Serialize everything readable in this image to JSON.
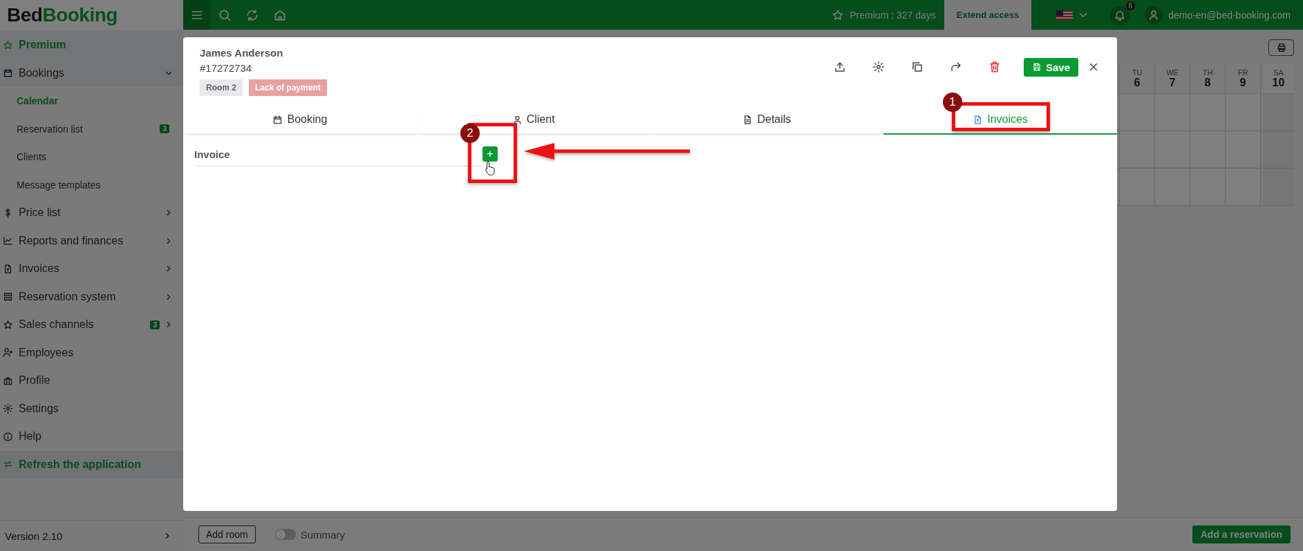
{
  "topbar": {
    "logo": {
      "first": "Bed",
      "second": "Booking"
    },
    "premium": "Premium : 327 days",
    "extend": "Extend access",
    "notifications": "6",
    "user": "demo-en@bed-booking.com"
  },
  "sidebar": {
    "items": [
      {
        "kind": "premium",
        "label": "Premium"
      },
      {
        "kind": "group",
        "label": "Bookings",
        "expanded": true,
        "children": [
          {
            "label": "Calendar",
            "selected": true
          },
          {
            "label": "Reservation list",
            "selected": false,
            "badge": "3"
          },
          {
            "label": "Clients",
            "selected": false
          },
          {
            "label": "Message templates",
            "selected": false
          }
        ]
      },
      {
        "kind": "group",
        "label": "Price list",
        "expanded": false
      },
      {
        "kind": "group",
        "label": "Reports and finances",
        "expanded": false
      },
      {
        "kind": "group",
        "label": "Invoices",
        "expanded": false
      },
      {
        "kind": "group",
        "label": "Reservation system",
        "expanded": false
      },
      {
        "kind": "group",
        "label": "Sales channels",
        "expanded": false,
        "badge": "3"
      },
      {
        "kind": "link",
        "label": "Employees"
      },
      {
        "kind": "link",
        "label": "Profile"
      },
      {
        "kind": "link",
        "label": "Settings"
      },
      {
        "kind": "link",
        "label": "Help"
      },
      {
        "kind": "refresh",
        "label": "Refresh the application"
      }
    ],
    "version": "Version 2.10"
  },
  "calendar": {
    "days": [
      {
        "weekday": "TU",
        "day": "6",
        "weekend": false
      },
      {
        "weekday": "WE",
        "day": "7",
        "weekend": false
      },
      {
        "weekday": "TH",
        "day": "8",
        "weekend": false
      },
      {
        "weekday": "FR",
        "day": "9",
        "weekend": false
      },
      {
        "weekday": "SA",
        "day": "10",
        "weekend": true
      }
    ]
  },
  "bottom_bar": {
    "add_room": "Add room",
    "summary": {
      "label": "Summary",
      "on": false
    },
    "add_reservation": "Add a reservation"
  },
  "modal": {
    "title": "James Anderson",
    "number": "#17272734",
    "tags": [
      {
        "label": "Room 2",
        "color": "#e9e9ec"
      },
      {
        "label": "Lack of payment",
        "color": "#e8a0a0"
      }
    ],
    "save": "Save",
    "tabs": [
      {
        "label": "Booking",
        "selected": false
      },
      {
        "label": "Client",
        "selected": false
      },
      {
        "label": "Details",
        "selected": false
      },
      {
        "label": "Invoices",
        "selected": true
      }
    ],
    "invoice": {
      "label": "Invoice",
      "add": "+"
    },
    "annotations": [
      {
        "number": "1"
      },
      {
        "number": "2"
      }
    ]
  }
}
